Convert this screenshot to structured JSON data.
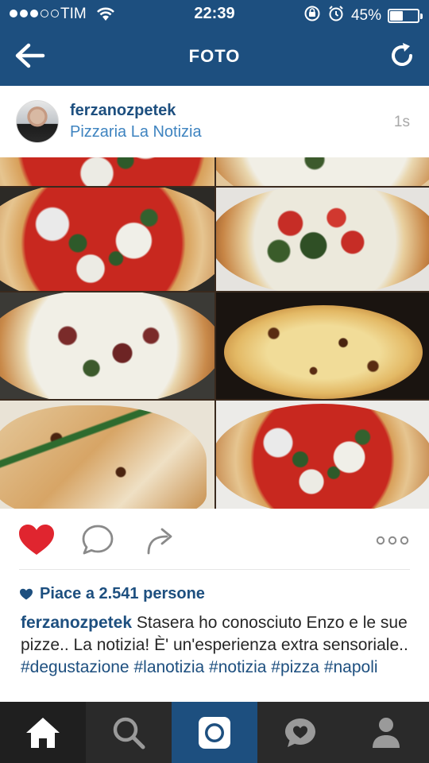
{
  "status_bar": {
    "carrier": "TIM",
    "time": "22:39",
    "battery": "45%",
    "battery_level": 0.45
  },
  "nav": {
    "title": "FOTO"
  },
  "post": {
    "username": "ferzanozpetek",
    "location": "Pizzaria La Notizia",
    "time_ago": "1s",
    "likes_text": "Piace a 2.541 persone",
    "caption_user": "ferzanozpetek",
    "caption_text": "Stasera ho conosciuto Enzo e le sue pizze.. La notizia! È' un'esperienza extra sensoriale..",
    "hashtags": [
      "#degustazione",
      "#lanotizia",
      "#notizia",
      "#pizza",
      "#napoli"
    ],
    "liked": true
  },
  "colors": {
    "brand_blue": "#1d4f7f",
    "link_blue": "#3f84c0",
    "like_red": "#e0252f",
    "tab_bg": "#2a2a2a"
  },
  "icons": {
    "back": "arrow-left-icon",
    "refresh": "refresh-icon",
    "like": "heart-icon",
    "comment": "comment-icon",
    "share": "share-icon",
    "more": "more-icon",
    "home": "home-icon",
    "explore": "search-icon",
    "camera": "camera-icon",
    "activity": "activity-icon",
    "profile": "profile-icon"
  }
}
